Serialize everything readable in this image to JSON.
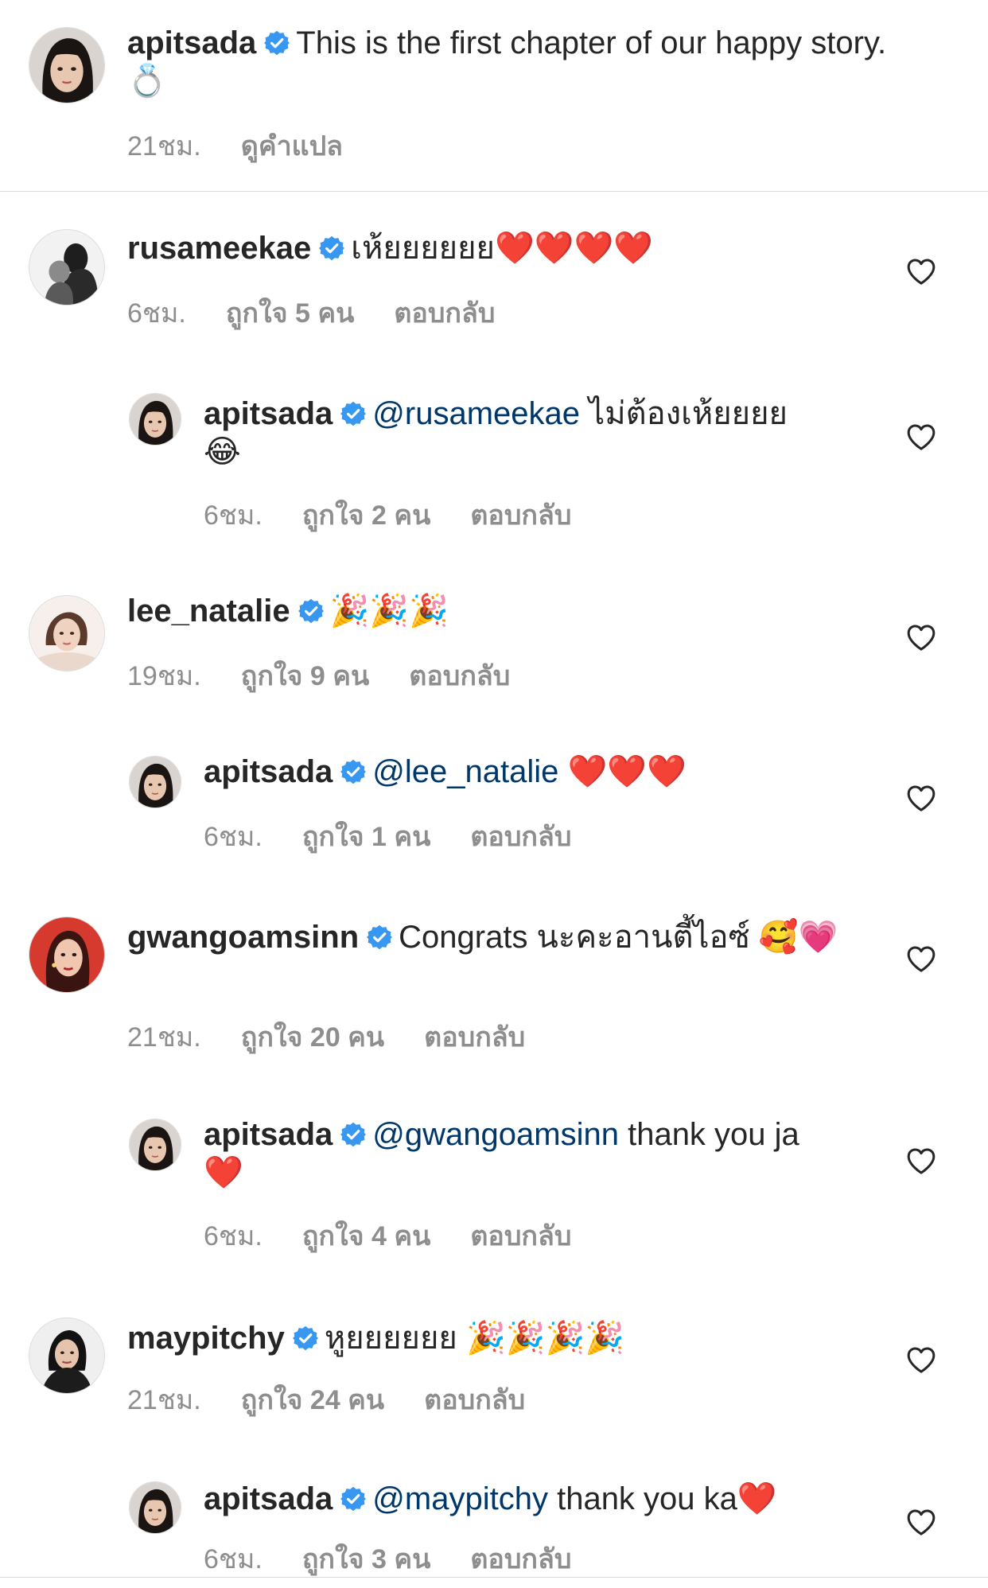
{
  "caption": {
    "username": "apitsada",
    "text": "This is the first chapter of our happy story.",
    "emoji": "💍",
    "time": "21ชม.",
    "translate": "ดูคำแปล"
  },
  "comments": [
    {
      "username": "rusameekae",
      "text": "เห้ยยยยยย",
      "emoji": "❤️❤️❤️❤️",
      "time": "6ชม.",
      "likes": "ถูกใจ 5 คน",
      "reply": "ตอบกลับ"
    },
    {
      "username": "apitsada",
      "mention": "@rusameekae",
      "text": " ไม่ต้องเห้ยยยย",
      "emoji": "😂",
      "time": "6ชม.",
      "likes": "ถูกใจ 2 คน",
      "reply": "ตอบกลับ"
    },
    {
      "username": "lee_natalie",
      "text": "",
      "emoji": "🎉🎉🎉",
      "time": "19ชม.",
      "likes": "ถูกใจ 9 คน",
      "reply": "ตอบกลับ"
    },
    {
      "username": "apitsada",
      "mention": "@lee_natalie",
      "text": " ",
      "emoji": "❤️❤️❤️",
      "time": "6ชม.",
      "likes": "ถูกใจ 1 คน",
      "reply": "ตอบกลับ"
    },
    {
      "username": "gwangoamsinn",
      "text": "Congrats นะคะอานตี้ไอซ์ ",
      "emoji": "🥰💗",
      "time": "21ชม.",
      "likes": "ถูกใจ 20 คน",
      "reply": "ตอบกลับ"
    },
    {
      "username": "apitsada",
      "mention": "@gwangoamsinn",
      "text": " thank you ja",
      "emoji": "❤️",
      "time": "6ชม.",
      "likes": "ถูกใจ 4 คน",
      "reply": "ตอบกลับ"
    },
    {
      "username": "maypitchy",
      "text": "หูยยยยยย ",
      "emoji": "🎉🎉🎉🎉",
      "time": "21ชม.",
      "likes": "ถูกใจ 24 คน",
      "reply": "ตอบกลับ"
    },
    {
      "username": "apitsada",
      "mention": "@maypitchy",
      "text": " thank you ka",
      "emoji": "❤️",
      "time": "6ชม.",
      "likes": "ถูกใจ 3 คน",
      "reply": "ตอบกลับ"
    }
  ],
  "colors": {
    "mention": "#00376b",
    "meta": "#8e8e8e",
    "verified": "#3897f0",
    "divider": "#dbdbdb"
  },
  "icons": {
    "verified": "verified-badge-icon",
    "like": "heart-outline-icon"
  }
}
